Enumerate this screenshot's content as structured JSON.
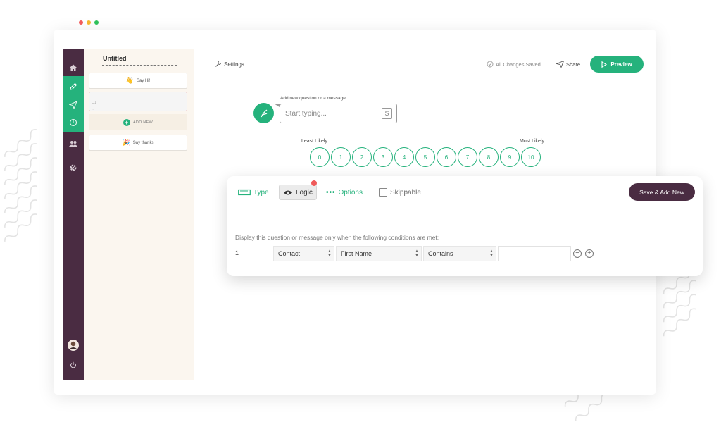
{
  "sidebar": {
    "doc_title": "Untitled",
    "questions": [
      {
        "label": "Say Hi!",
        "emoji": "👋"
      },
      {
        "label": "Q1",
        "sub": "..."
      },
      {
        "label": "Say thanks",
        "emoji": "🎉"
      }
    ],
    "add_new": "ADD NEW"
  },
  "topbar": {
    "settings": "Settings",
    "saved": "All Changes Saved",
    "share": "Share",
    "preview": "Preview"
  },
  "editor": {
    "add_label": "Add new question or a message",
    "placeholder": "Start typing...",
    "currency_symbol": "$",
    "least": "Least Likely",
    "most": "Most Likely",
    "scale": [
      "0",
      "1",
      "2",
      "3",
      "4",
      "5",
      "6",
      "7",
      "8",
      "9",
      "10"
    ]
  },
  "card": {
    "tab_type": "Type",
    "tab_logic": "Logic",
    "tab_options": "Options",
    "tab_skip": "Skippable",
    "save_add": "Save & Add New",
    "condition_label": "Display this question or message only when the following conditions are met:",
    "row_number": "1",
    "field1": "Contact",
    "field2": "First Name",
    "field3": "Contains"
  },
  "colors": {
    "accent": "#25b27c",
    "rail": "#4a2c42",
    "panel": "#fbf6ef"
  }
}
